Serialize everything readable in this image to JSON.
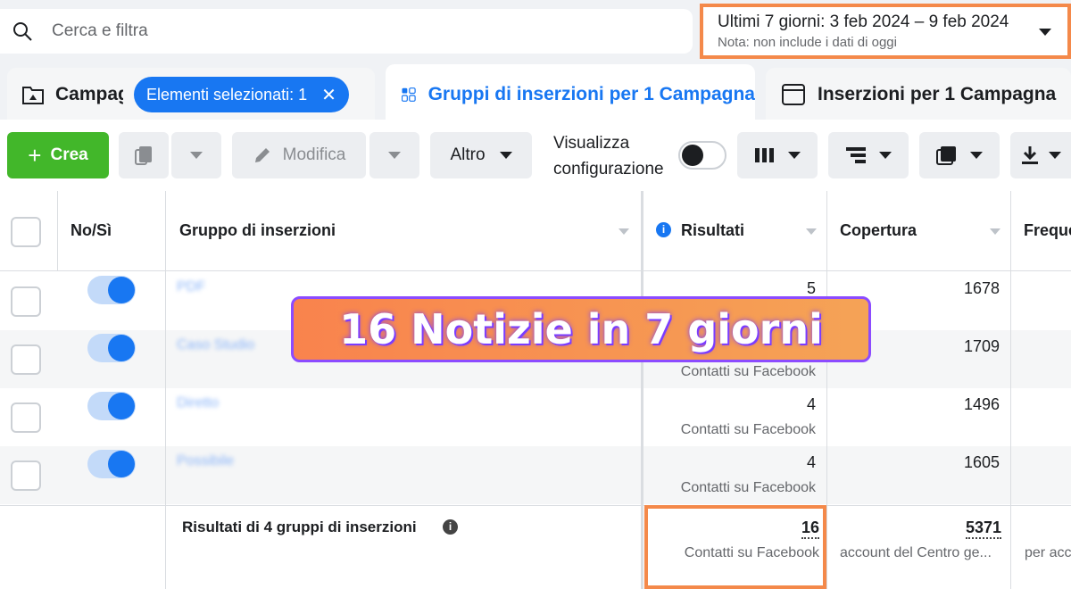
{
  "search": {
    "placeholder": "Cerca e filtra"
  },
  "date_range": {
    "label": "Ultimi 7 giorni: 3 feb 2024 – 9 feb 2024",
    "note": "Nota: non include i dati di oggi"
  },
  "tabs": [
    {
      "label": "Campagne",
      "selected_badge": "Elementi selezionati: 1"
    },
    {
      "label": "Gruppi di inserzioni per 1 Campagna"
    },
    {
      "label": "Inserzioni per 1 Campagna"
    }
  ],
  "toolbar": {
    "create_label": "Crea",
    "edit_label": "Modifica",
    "more_label": "Altro",
    "view_config_label": "Visualizza configurazione"
  },
  "table": {
    "headers": {
      "toggle": "No/Sì",
      "adset": "Gruppo di inserzioni",
      "results": "Risultati",
      "reach": "Copertura",
      "frequency": "Frequenza"
    },
    "rows": [
      {
        "name": "PDF",
        "results": "5",
        "results_type": "",
        "reach": "1678"
      },
      {
        "name": "Caso Studio",
        "results": "",
        "results_type": "Contatti su Facebook",
        "reach": "1709"
      },
      {
        "name": "Diretto",
        "results": "4",
        "results_type": "Contatti su Facebook",
        "reach": "1496"
      },
      {
        "name": "Possibile",
        "results": "4",
        "results_type": "Contatti su Facebook",
        "reach": "1605"
      }
    ],
    "summary": {
      "label": "Risultati di 4 gruppi di inserzioni",
      "results": "16",
      "results_type": "Contatti su Facebook",
      "reach": "5371",
      "reach_type": "account del Centro ge...",
      "frequency_type": "per acc"
    }
  },
  "banner": {
    "text": "16 Notizie in 7 giorni"
  },
  "colors": {
    "accent": "#1877f2",
    "create": "#42b72a",
    "highlight": "#f4894a"
  }
}
